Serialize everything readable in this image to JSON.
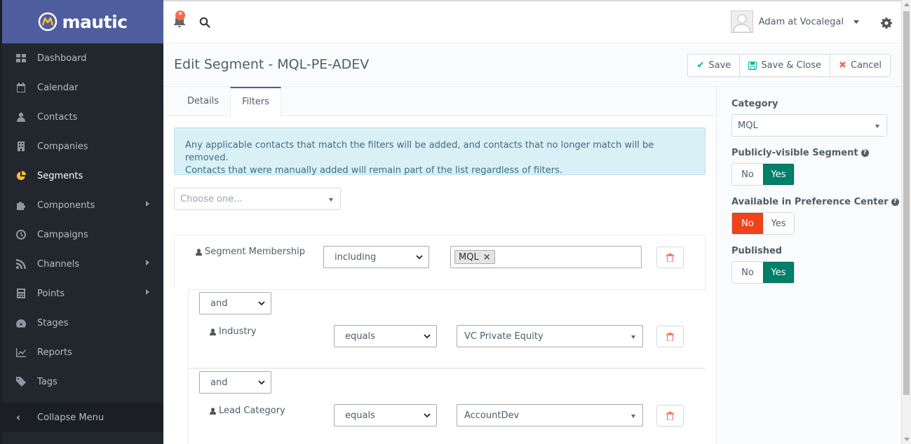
{
  "brand": {
    "name": "mautic"
  },
  "sidebar": {
    "items": [
      {
        "label": "Dashboard",
        "icon": "dashboard-icon",
        "active": false,
        "has_arrow": false
      },
      {
        "label": "Calendar",
        "icon": "calendar-icon",
        "active": false,
        "has_arrow": false
      },
      {
        "label": "Contacts",
        "icon": "user-icon",
        "active": false,
        "has_arrow": false
      },
      {
        "label": "Companies",
        "icon": "building-icon",
        "active": false,
        "has_arrow": false
      },
      {
        "label": "Segments",
        "icon": "pie-chart-icon",
        "active": true,
        "has_arrow": false
      },
      {
        "label": "Components",
        "icon": "puzzle-icon",
        "active": false,
        "has_arrow": true
      },
      {
        "label": "Campaigns",
        "icon": "clock-icon",
        "active": false,
        "has_arrow": false
      },
      {
        "label": "Channels",
        "icon": "rss-icon",
        "active": false,
        "has_arrow": true
      },
      {
        "label": "Points",
        "icon": "calculator-icon",
        "active": false,
        "has_arrow": true
      },
      {
        "label": "Stages",
        "icon": "tachometer-icon",
        "active": false,
        "has_arrow": false
      },
      {
        "label": "Reports",
        "icon": "line-chart-icon",
        "active": false,
        "has_arrow": false
      },
      {
        "label": "Tags",
        "icon": "tag-icon",
        "active": false,
        "has_arrow": false
      }
    ],
    "collapse_label": "Collapse Menu"
  },
  "topbar": {
    "notification_badge": "*",
    "user_name": "Adam at Vocalegal"
  },
  "header": {
    "title": "Edit Segment - MQL-PE-ADEV",
    "save_label": "Save",
    "save_close_label": "Save & Close",
    "cancel_label": "Cancel"
  },
  "tabs": [
    {
      "label": "Details",
      "active": false
    },
    {
      "label": "Filters",
      "active": true
    }
  ],
  "filters": {
    "info_line1": "Any applicable contacts that match the filters will be added, and contacts that no longer match will be removed.",
    "info_line2": "Contacts that were manually added will remain part of the list regardless of filters.",
    "choose_placeholder": "Choose one...",
    "rows": [
      {
        "glue": "",
        "label": "Segment Membership",
        "operator": "including",
        "value_tag": "MQL"
      },
      {
        "glue": "and",
        "label": "Industry",
        "operator": "equals",
        "value": "VC Private Equity"
      },
      {
        "glue": "and",
        "label": "Lead Category",
        "operator": "equals",
        "value": "AccountDev"
      }
    ]
  },
  "right_panel": {
    "category_label": "Category",
    "category_value": "MQL",
    "public_label": "Publicly-visible Segment",
    "preference_label": "Available in Preference Center",
    "published_label": "Published",
    "no_label": "No",
    "yes_label": "Yes",
    "public_value": "Yes",
    "preference_value": "No",
    "published_value": "Yes"
  },
  "colors": {
    "brand": "#4e5d9d",
    "sidebar_bg": "#22272d",
    "active_icon": "#fdb933",
    "toggle_yes": "#00806a",
    "toggle_no": "#f0431a",
    "alert_bg": "#daf0f7"
  }
}
